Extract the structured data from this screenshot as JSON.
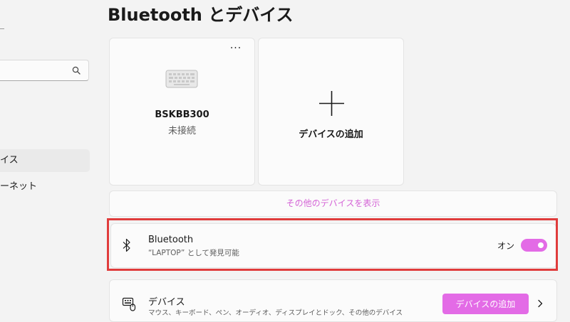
{
  "page": {
    "title": "Bluetooth とデバイス"
  },
  "sidebar": {
    "search_placeholder": "",
    "items": [
      {
        "label": "イス",
        "active": true
      },
      {
        "label": "ーネット",
        "active": false
      }
    ]
  },
  "device_cards": [
    {
      "name": "BSKBB300",
      "status": "未接続",
      "icon": "keyboard-icon",
      "more_label": "···"
    }
  ],
  "add_card": {
    "label": "デバイスの追加",
    "icon": "plus-icon"
  },
  "show_more": {
    "label": "その他のデバイスを表示"
  },
  "bluetooth": {
    "title": "Bluetooth",
    "subtitle": "“LAPTOP” として発見可能",
    "state_label": "オン",
    "enabled": true,
    "icon": "bluetooth-icon"
  },
  "devices_section": {
    "title": "デバイス",
    "subtitle": "マウス、キーボード、ペン、オーディオ、ディスプレイとドック、その他のデバイス",
    "button_label": "デバイスの追加",
    "icon": "devices-icon"
  },
  "colors": {
    "accent": "#e36be6",
    "link": "#d463d6",
    "highlight": "#e03c3c"
  }
}
